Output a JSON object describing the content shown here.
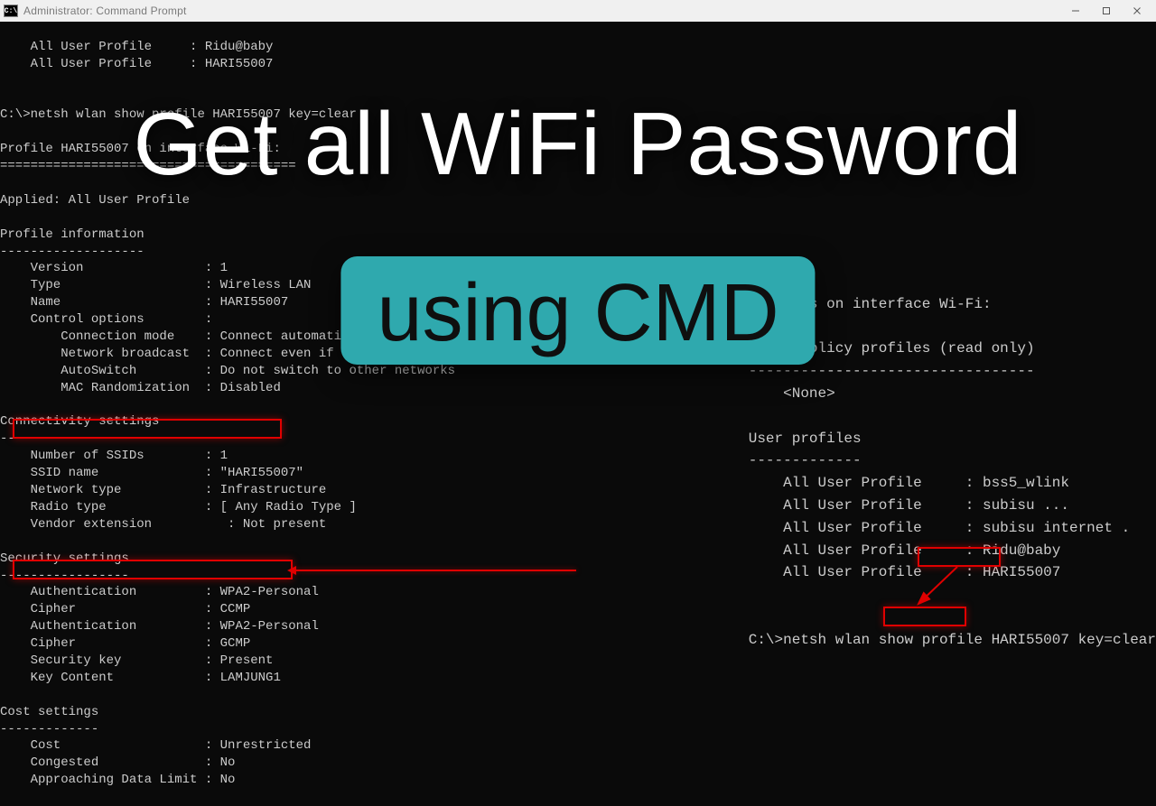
{
  "window": {
    "title": "Administrator: Command Prompt",
    "icon_label": "C:\\"
  },
  "left": {
    "users_top": [
      "    All User Profile     : Ridu@baby",
      "    All User Profile     : HARI55007"
    ],
    "prompt": "C:\\>",
    "cmd": "netsh wlan show profile HARI55007 key=clear",
    "profile_on_interface": "Profile HARI55007 on interface Wi-Fi:",
    "divider1": "=======================================",
    "applied": "Applied: All User Profile",
    "sec_profile_info": "Profile information",
    "dash1": "-------------------",
    "pi_lines": [
      "    Version                : 1",
      "    Type                   : Wireless LAN",
      "    Name                   : HARI55007",
      "    Control options        :",
      "        Connection mode    : Connect automatically",
      "        Network broadcast  : Connect even if this network is not broadcasting",
      "        AutoSwitch         : Do not switch to other networks",
      "        MAC Randomization  : Disabled"
    ],
    "sec_conn": "Connectivity settings",
    "dash2": "---------------------",
    "conn_lines": [
      "    Number of SSIDs        : 1",
      "    SSID name              : \"HARI55007\"",
      "    Network type           : Infrastructure",
      "    Radio type             : [ Any Radio Type ]",
      "    Vendor extension          : Not present"
    ],
    "sec_security": "Security settings",
    "dash3": "-----------------",
    "sec_lines": [
      "    Authentication         : WPA2-Personal",
      "    Cipher                 : CCMP",
      "    Authentication         : WPA2-Personal",
      "    Cipher                 : GCMP",
      "    Security key           : Present",
      "    Key Content            : LAMJUNG1"
    ],
    "sec_cost": "Cost settings",
    "dash4": "-------------",
    "cost_lines": [
      "    Cost                   : Unrestricted",
      "    Congested              : No",
      "    Approaching Data Limit : No"
    ]
  },
  "right": {
    "profiles_on": "Profiles on interface Wi-Fi:",
    "group": "Group policy profiles (read only)",
    "dash_g": "---------------------------------",
    "none": "    <None>",
    "user_profiles": "User profiles",
    "dash_u": "-------------",
    "user_rows": [
      "    All User Profile     : bss5_wlink",
      "    All User Profile     : subisu ...",
      "    All User Profile     : subisu internet .",
      "    All User Profile     : Ridu@baby",
      "    All User Profile     : HARI55007"
    ],
    "prompt": "C:\\>",
    "cmd_full": "netsh wlan show profile HARI55007 key=clear"
  },
  "overlay": {
    "headline": "Get all WiFi Password",
    "sub": "using CMD"
  }
}
